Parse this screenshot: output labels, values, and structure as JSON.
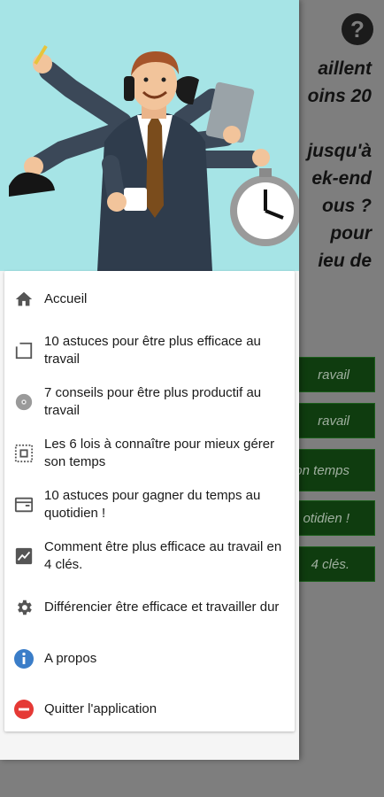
{
  "background": {
    "help_label": "?",
    "text_lines": [
      "aillent",
      "oins 20",
      "",
      "jusqu'à",
      "ek-end",
      "ous ?",
      "pour",
      "ieu de"
    ],
    "buttons": [
      "ravail",
      "ravail",
      "on temps",
      "otidien !",
      "4 clés."
    ]
  },
  "menu": {
    "items": [
      {
        "icon": "home-icon",
        "label": "Accueil"
      },
      {
        "icon": "square-icon",
        "label": "10 astuces pour être plus efficace au travail"
      },
      {
        "icon": "disc-icon",
        "label": "7 conseils pour être plus productif au travail"
      },
      {
        "icon": "dotted-frame-icon",
        "label": "Les 6 lois à connaître pour mieux gérer son temps"
      },
      {
        "icon": "window-icon",
        "label": "10 astuces pour gagner du temps au quotidien !"
      },
      {
        "icon": "chart-icon",
        "label": "Comment être plus efficace au travail en 4 clés."
      },
      {
        "icon": "gear-icon",
        "label": "Différencier être efficace et travailler dur"
      },
      {
        "icon": "info-icon",
        "label": "A propos"
      },
      {
        "icon": "exit-icon",
        "label": "Quitter l'application"
      }
    ]
  },
  "colors": {
    "hero_bg": "#a6e4e6",
    "info_blue": "#3a7dc8",
    "exit_red": "#e53935",
    "button_green": "#0f3c0f"
  }
}
